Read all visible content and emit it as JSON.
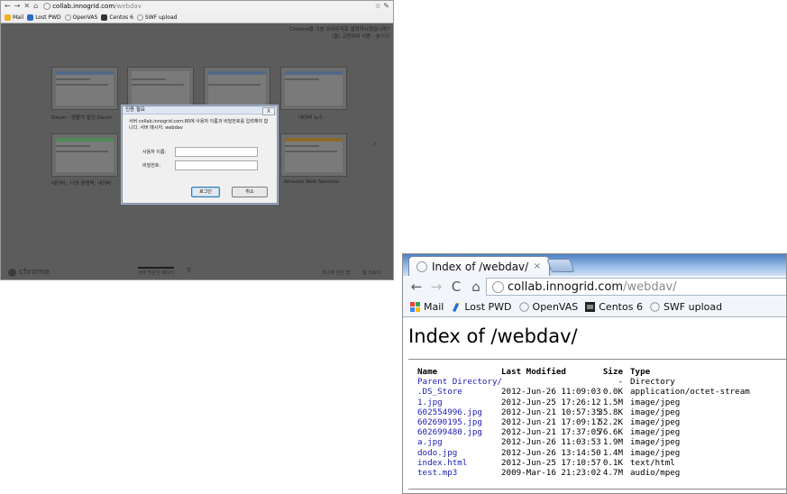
{
  "shot1": {
    "navbar": {
      "host": "collab.innogrid.com",
      "path": "/webdav"
    },
    "bookmarks": [
      {
        "label": "Mail",
        "icon": "mail-icon",
        "color": "#f2b01e"
      },
      {
        "label": "Lost PWD",
        "icon": "key-icon",
        "color": "#2a6dc9"
      },
      {
        "label": "OpenVAS",
        "icon": "globe-icon",
        "color": "#9a9a9a"
      },
      {
        "label": "Centos 6",
        "icon": "centos-icon",
        "color": "#333333"
      },
      {
        "label": "SWF upload",
        "icon": "globe-icon",
        "color": "#9a9a9a"
      }
    ],
    "ntp_notice_line1": "Chrome을 기본 브라우저로 설정하시겠습니까?",
    "ntp_notice_line2": "(을) 고정하여 사용 - 숨기기",
    "thumbnails": [
      {
        "label": "Daum - 생활의 발견 Daum"
      },
      {
        "label": ""
      },
      {
        "label": ""
      },
      {
        "label": "네이버 뉴스"
      },
      {
        "label": "네이버 : 나의 경쟁력, 네이버"
      },
      {
        "label": ""
      },
      {
        "label": ""
      },
      {
        "label": "Amazon Web Services"
      }
    ],
    "footer": {
      "logo": "chrome",
      "tab_most_visited": "자주 방문한 페이지",
      "tab_apps": "앱",
      "recently_closed": "최근에 닫은 탭",
      "web_store": "웹 스토어"
    },
    "dialog": {
      "title": "인증 필요",
      "close": "X",
      "message": "서버 collab.innogrid.com:80에 사용자 이름과 비밀번호를 입력해야 합니다. 서버 메시지: webdav",
      "username_label": "사용자 이름:",
      "password_label": "비밀번호:",
      "login_button": "로그인",
      "cancel_button": "취소"
    }
  },
  "shot2": {
    "tab_title": "Index of /webdav/",
    "tab_close": "×",
    "url_host": "collab.innogrid.com",
    "url_path": "/webdav/",
    "bookmarks": [
      {
        "label": "Mail",
        "icon": "mail-icon"
      },
      {
        "label": "Lost PWD",
        "icon": "key-icon"
      },
      {
        "label": "OpenVAS",
        "icon": "globe-icon"
      },
      {
        "label": "Centos 6",
        "icon": "centos-icon"
      },
      {
        "label": "SWF upload",
        "icon": "globe-icon"
      }
    ],
    "heading": "Index of /webdav/",
    "columns": [
      "Name",
      "Last Modified",
      "Size",
      "Type"
    ],
    "rows": [
      {
        "name": "Parent Directory/",
        "modified": "",
        "size": "-",
        "type": "Directory"
      },
      {
        "name": ".DS_Store",
        "modified": "2012-Jun-26 11:09:03",
        "size": "0.0K",
        "type": "application/octet-stream"
      },
      {
        "name": "1.jpg",
        "modified": "2012-Jun-25 17:26:12",
        "size": "1.5M",
        "type": "image/jpeg"
      },
      {
        "name": "602554996.jpg",
        "modified": "2012-Jun-21 10:57:35",
        "size": "35.8K",
        "type": "image/jpeg"
      },
      {
        "name": "602690195.jpg",
        "modified": "2012-Jun-21 17:09:17",
        "size": "52.2K",
        "type": "image/jpeg"
      },
      {
        "name": "602699480.jpg",
        "modified": "2012-Jun-21 17:37:05",
        "size": "76.6K",
        "type": "image/jpeg"
      },
      {
        "name": "a.jpg",
        "modified": "2012-Jun-26 11:03:53",
        "size": "1.9M",
        "type": "image/jpeg"
      },
      {
        "name": "dodo.jpg",
        "modified": "2012-Jun-26 13:14:50",
        "size": "1.4M",
        "type": "image/jpeg"
      },
      {
        "name": "index.html",
        "modified": "2012-Jun-25 17:10:57",
        "size": "0.1K",
        "type": "text/html"
      },
      {
        "name": "test.mp3",
        "modified": "2009-Mar-16 21:23:02",
        "size": "4.7M",
        "type": "audio/mpeg"
      }
    ]
  }
}
